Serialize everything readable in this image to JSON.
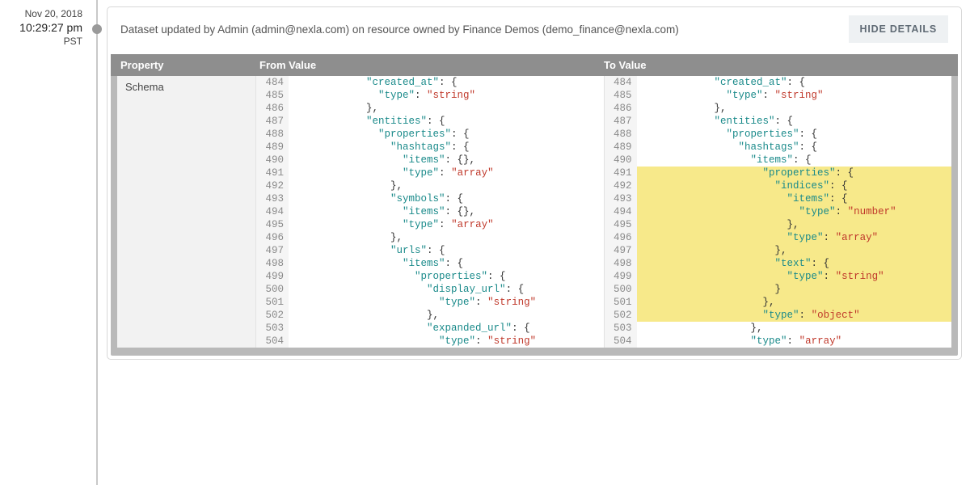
{
  "timestamp": {
    "date": "Nov 20, 2018",
    "time": "10:29:27 pm",
    "tz": "PST"
  },
  "event_description": "Dataset updated by Admin (admin@nexla.com) on resource owned by Finance Demos (demo_finance@nexla.com)",
  "buttons": {
    "hide_details": "HIDE DETAILS"
  },
  "table_headers": {
    "property": "Property",
    "from": "From Value",
    "to": "To Value"
  },
  "property_label": "Schema",
  "from_lines": [
    {
      "n": 484,
      "indent": 8,
      "hl": false,
      "segs": [
        [
          "key",
          "\"created_at\""
        ],
        [
          "punc",
          ": {"
        ]
      ]
    },
    {
      "n": 485,
      "indent": 10,
      "hl": false,
      "segs": [
        [
          "key",
          "\"type\""
        ],
        [
          "punc",
          ": "
        ],
        [
          "str",
          "\"string\""
        ]
      ]
    },
    {
      "n": 486,
      "indent": 8,
      "hl": false,
      "segs": [
        [
          "punc",
          "},"
        ]
      ]
    },
    {
      "n": 487,
      "indent": 8,
      "hl": false,
      "segs": [
        [
          "key",
          "\"entities\""
        ],
        [
          "punc",
          ": {"
        ]
      ]
    },
    {
      "n": 488,
      "indent": 10,
      "hl": false,
      "segs": [
        [
          "key",
          "\"properties\""
        ],
        [
          "punc",
          ": {"
        ]
      ]
    },
    {
      "n": 489,
      "indent": 12,
      "hl": false,
      "segs": [
        [
          "key",
          "\"hashtags\""
        ],
        [
          "punc",
          ": {"
        ]
      ]
    },
    {
      "n": 490,
      "indent": 14,
      "hl": false,
      "segs": [
        [
          "key",
          "\"items\""
        ],
        [
          "punc",
          ": {},"
        ]
      ]
    },
    {
      "n": 491,
      "indent": 14,
      "hl": false,
      "segs": [
        [
          "key",
          "\"type\""
        ],
        [
          "punc",
          ": "
        ],
        [
          "str",
          "\"array\""
        ]
      ]
    },
    {
      "n": 492,
      "indent": 12,
      "hl": false,
      "segs": [
        [
          "punc",
          "},"
        ]
      ]
    },
    {
      "n": 493,
      "indent": 12,
      "hl": false,
      "segs": [
        [
          "key",
          "\"symbols\""
        ],
        [
          "punc",
          ": {"
        ]
      ]
    },
    {
      "n": 494,
      "indent": 14,
      "hl": false,
      "segs": [
        [
          "key",
          "\"items\""
        ],
        [
          "punc",
          ": {},"
        ]
      ]
    },
    {
      "n": 495,
      "indent": 14,
      "hl": false,
      "segs": [
        [
          "key",
          "\"type\""
        ],
        [
          "punc",
          ": "
        ],
        [
          "str",
          "\"array\""
        ]
      ]
    },
    {
      "n": 496,
      "indent": 12,
      "hl": false,
      "segs": [
        [
          "punc",
          "},"
        ]
      ]
    },
    {
      "n": 497,
      "indent": 12,
      "hl": false,
      "segs": [
        [
          "key",
          "\"urls\""
        ],
        [
          "punc",
          ": {"
        ]
      ]
    },
    {
      "n": 498,
      "indent": 14,
      "hl": false,
      "segs": [
        [
          "key",
          "\"items\""
        ],
        [
          "punc",
          ": {"
        ]
      ]
    },
    {
      "n": 499,
      "indent": 16,
      "hl": false,
      "segs": [
        [
          "key",
          "\"properties\""
        ],
        [
          "punc",
          ": {"
        ]
      ]
    },
    {
      "n": 500,
      "indent": 18,
      "hl": false,
      "segs": [
        [
          "key",
          "\"display_url\""
        ],
        [
          "punc",
          ": {"
        ]
      ]
    },
    {
      "n": 501,
      "indent": 20,
      "hl": false,
      "segs": [
        [
          "key",
          "\"type\""
        ],
        [
          "punc",
          ": "
        ],
        [
          "str",
          "\"string\""
        ]
      ]
    },
    {
      "n": 502,
      "indent": 18,
      "hl": false,
      "segs": [
        [
          "punc",
          "},"
        ]
      ]
    },
    {
      "n": 503,
      "indent": 18,
      "hl": false,
      "segs": [
        [
          "key",
          "\"expanded_url\""
        ],
        [
          "punc",
          ": {"
        ]
      ]
    },
    {
      "n": 504,
      "indent": 20,
      "hl": false,
      "segs": [
        [
          "key",
          "\"type\""
        ],
        [
          "punc",
          ": "
        ],
        [
          "str",
          "\"string\""
        ]
      ]
    }
  ],
  "to_lines": [
    {
      "n": 484,
      "indent": 8,
      "hl": false,
      "segs": [
        [
          "key",
          "\"created_at\""
        ],
        [
          "punc",
          ": {"
        ]
      ]
    },
    {
      "n": 485,
      "indent": 10,
      "hl": false,
      "segs": [
        [
          "key",
          "\"type\""
        ],
        [
          "punc",
          ": "
        ],
        [
          "str",
          "\"string\""
        ]
      ]
    },
    {
      "n": 486,
      "indent": 8,
      "hl": false,
      "segs": [
        [
          "punc",
          "},"
        ]
      ]
    },
    {
      "n": 487,
      "indent": 8,
      "hl": false,
      "segs": [
        [
          "key",
          "\"entities\""
        ],
        [
          "punc",
          ": {"
        ]
      ]
    },
    {
      "n": 488,
      "indent": 10,
      "hl": false,
      "segs": [
        [
          "key",
          "\"properties\""
        ],
        [
          "punc",
          ": {"
        ]
      ]
    },
    {
      "n": 489,
      "indent": 12,
      "hl": false,
      "segs": [
        [
          "key",
          "\"hashtags\""
        ],
        [
          "punc",
          ": {"
        ]
      ]
    },
    {
      "n": 490,
      "indent": 14,
      "hl": false,
      "segs": [
        [
          "key",
          "\"items\""
        ],
        [
          "punc",
          ": {"
        ]
      ]
    },
    {
      "n": 491,
      "indent": 16,
      "hl": true,
      "segs": [
        [
          "key",
          "\"properties\""
        ],
        [
          "punc",
          ": {"
        ]
      ]
    },
    {
      "n": 492,
      "indent": 18,
      "hl": true,
      "segs": [
        [
          "key",
          "\"indices\""
        ],
        [
          "punc",
          ": {"
        ]
      ]
    },
    {
      "n": 493,
      "indent": 20,
      "hl": true,
      "segs": [
        [
          "key",
          "\"items\""
        ],
        [
          "punc",
          ": {"
        ]
      ]
    },
    {
      "n": 494,
      "indent": 22,
      "hl": true,
      "segs": [
        [
          "key",
          "\"type\""
        ],
        [
          "punc",
          ": "
        ],
        [
          "str",
          "\"number\""
        ]
      ]
    },
    {
      "n": 495,
      "indent": 20,
      "hl": true,
      "segs": [
        [
          "punc",
          "},"
        ]
      ]
    },
    {
      "n": 496,
      "indent": 20,
      "hl": true,
      "segs": [
        [
          "key",
          "\"type\""
        ],
        [
          "punc",
          ": "
        ],
        [
          "str",
          "\"array\""
        ]
      ]
    },
    {
      "n": 497,
      "indent": 18,
      "hl": true,
      "segs": [
        [
          "punc",
          "},"
        ]
      ]
    },
    {
      "n": 498,
      "indent": 18,
      "hl": true,
      "segs": [
        [
          "key",
          "\"text\""
        ],
        [
          "punc",
          ": {"
        ]
      ]
    },
    {
      "n": 499,
      "indent": 20,
      "hl": true,
      "segs": [
        [
          "key",
          "\"type\""
        ],
        [
          "punc",
          ": "
        ],
        [
          "str",
          "\"string\""
        ]
      ]
    },
    {
      "n": 500,
      "indent": 18,
      "hl": true,
      "segs": [
        [
          "punc",
          "}"
        ]
      ]
    },
    {
      "n": 501,
      "indent": 16,
      "hl": true,
      "segs": [
        [
          "punc",
          "},"
        ]
      ]
    },
    {
      "n": 502,
      "indent": 16,
      "hl": true,
      "segs": [
        [
          "key",
          "\"type\""
        ],
        [
          "punc",
          ": "
        ],
        [
          "str",
          "\"object\""
        ]
      ]
    },
    {
      "n": 503,
      "indent": 14,
      "hl": false,
      "segs": [
        [
          "punc",
          "},"
        ]
      ]
    },
    {
      "n": 504,
      "indent": 14,
      "hl": false,
      "segs": [
        [
          "key",
          "\"type\""
        ],
        [
          "punc",
          ": "
        ],
        [
          "str",
          "\"array\""
        ]
      ]
    }
  ]
}
